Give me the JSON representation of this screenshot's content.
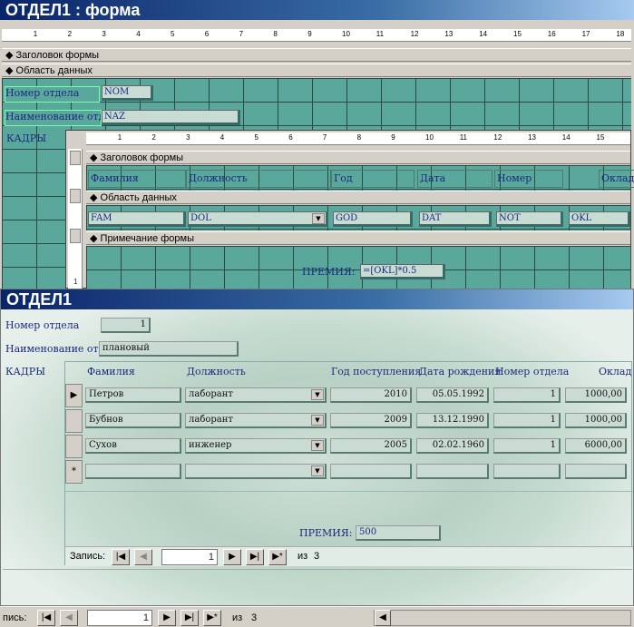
{
  "design": {
    "title": "ОТДЕЛ1 : форма",
    "ruler": [
      "1",
      "2",
      "3",
      "4",
      "5",
      "6",
      "7",
      "8",
      "9",
      "10",
      "11",
      "12",
      "13",
      "14",
      "15",
      "16",
      "17",
      "18"
    ],
    "sec_header": "Заголовок формы",
    "sec_data": "Область данных",
    "lbl_nom": "Номер отдела",
    "fld_nom": "NOM",
    "lbl_naz": "Наименование отдел",
    "fld_naz": "NAZ",
    "lbl_kadry": "КАДРЫ",
    "sub": {
      "ruler": [
        "1",
        "2",
        "3",
        "4",
        "5",
        "6",
        "7",
        "8",
        "9",
        "10",
        "11",
        "12",
        "13",
        "14",
        "15"
      ],
      "sec_header": "Заголовок формы",
      "cols": [
        "Фамилия",
        "Должность",
        "Год поступления",
        "Дата рождения",
        "Номер отдела",
        "Оклад"
      ],
      "sec_data": "Область данных",
      "fields": [
        "FAM",
        "DOL",
        "GOD",
        "DAT",
        "NOT",
        "OKL"
      ],
      "sec_footer": "Примечание формы",
      "prem_label": "ПРЕМИЯ:",
      "prem_expr": "=[OKL]*0.5",
      "vruler_last": "1"
    }
  },
  "form": {
    "title": "ОТДЕЛ1",
    "lbl_nom": "Номер отдела",
    "val_nom": "1",
    "lbl_naz": "Наименование отдел",
    "val_naz": "плановый",
    "lbl_kadry": "КАДРЫ",
    "cols": [
      "Фамилия",
      "Должность",
      "Год поступления",
      "Дата рождения",
      "Номер отдела",
      "Оклад"
    ],
    "rows": [
      {
        "fam": "Петров",
        "dol": "лаборант",
        "god": "2010",
        "dat": "05.05.1992",
        "not": "1",
        "okl": "1000,00"
      },
      {
        "fam": "Бубнов",
        "dol": "лаборант",
        "god": "2009",
        "dat": "13.12.1990",
        "not": "1",
        "okl": "1000,00"
      },
      {
        "fam": "Сухов",
        "dol": "инженер",
        "god": "2005",
        "dat": "02.02.1960",
        "not": "1",
        "okl": "6000,00"
      }
    ],
    "new_row_marker": "*",
    "current_row_marker": "▶",
    "prem_label": "ПРЕМИЯ:",
    "prem_val": "500",
    "nav": {
      "label": "Запись:",
      "current": "1",
      "of": "из",
      "total": "3"
    }
  },
  "outer_nav": {
    "label": "пись:",
    "current": "1",
    "of": "из",
    "total": "3"
  }
}
